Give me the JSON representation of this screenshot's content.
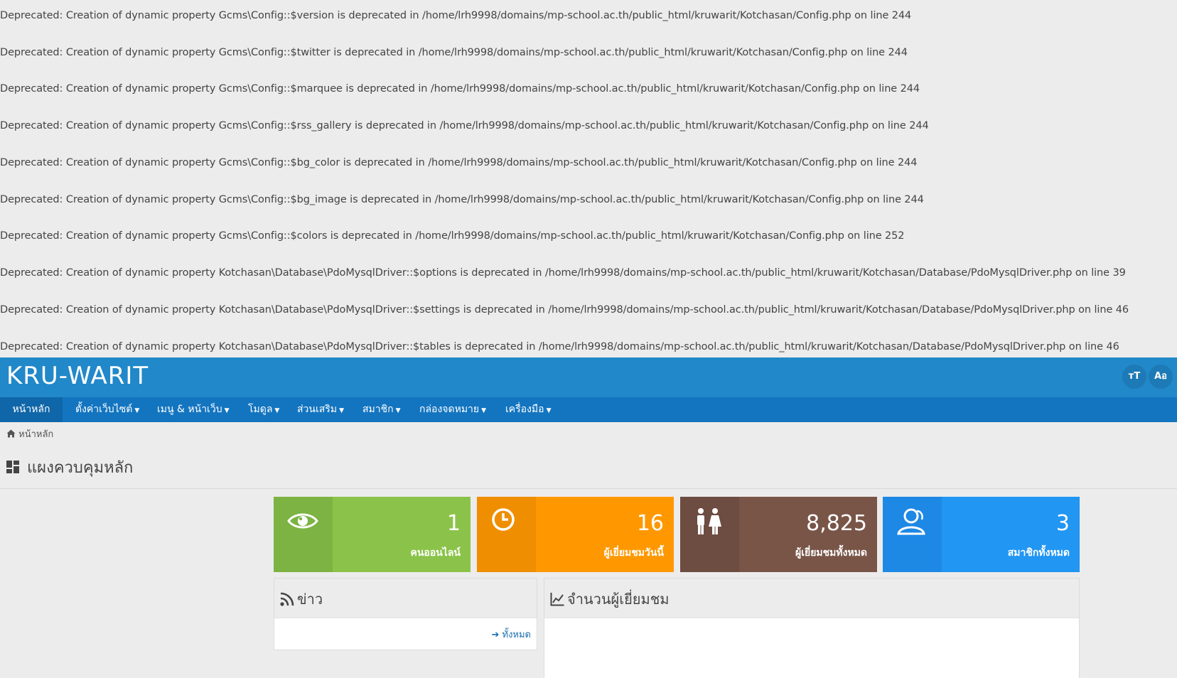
{
  "errors": [
    "Deprecated: Creation of dynamic property Gcms\\Config::$version is deprecated in /home/lrh9998/domains/mp-school.ac.th/public_html/kruwarit/Kotchasan/Config.php on line 244",
    "Deprecated: Creation of dynamic property Gcms\\Config::$twitter is deprecated in /home/lrh9998/domains/mp-school.ac.th/public_html/kruwarit/Kotchasan/Config.php on line 244",
    "Deprecated: Creation of dynamic property Gcms\\Config::$marquee is deprecated in /home/lrh9998/domains/mp-school.ac.th/public_html/kruwarit/Kotchasan/Config.php on line 244",
    "Deprecated: Creation of dynamic property Gcms\\Config::$rss_gallery is deprecated in /home/lrh9998/domains/mp-school.ac.th/public_html/kruwarit/Kotchasan/Config.php on line 244",
    "Deprecated: Creation of dynamic property Gcms\\Config::$bg_color is deprecated in /home/lrh9998/domains/mp-school.ac.th/public_html/kruwarit/Kotchasan/Config.php on line 244",
    "Deprecated: Creation of dynamic property Gcms\\Config::$bg_image is deprecated in /home/lrh9998/domains/mp-school.ac.th/public_html/kruwarit/Kotchasan/Config.php on line 244",
    "Deprecated: Creation of dynamic property Gcms\\Config::$colors is deprecated in /home/lrh9998/domains/mp-school.ac.th/public_html/kruwarit/Kotchasan/Config.php on line 252",
    "Deprecated: Creation of dynamic property Kotchasan\\Database\\PdoMysqlDriver::$options is deprecated in /home/lrh9998/domains/mp-school.ac.th/public_html/kruwarit/Kotchasan/Database/PdoMysqlDriver.php on line 39",
    "Deprecated: Creation of dynamic property Kotchasan\\Database\\PdoMysqlDriver::$settings is deprecated in /home/lrh9998/domains/mp-school.ac.th/public_html/kruwarit/Kotchasan/Database/PdoMysqlDriver.php on line 46",
    "Deprecated: Creation of dynamic property Kotchasan\\Database\\PdoMysqlDriver::$tables is deprecated in /home/lrh9998/domains/mp-school.ac.th/public_html/kruwarit/Kotchasan/Database/PdoMysqlDriver.php on line 46"
  ],
  "header": {
    "logo": "KRU-WARIT",
    "font_size_button": "тT",
    "language_button": "Aอ",
    "bg_color": "#2188c9"
  },
  "nav": {
    "items": [
      "หน้าหลัก",
      "ตั้งค่าเว็บไซต์",
      "เมนู & หน้าเว็บ",
      "โมดูล",
      "ส่วนเสริม",
      "สมาชิก",
      "กล่องจดหมาย",
      "เครื่องมือ"
    ],
    "bg_color": "#1375c0"
  },
  "breadcrumb": {
    "home_icon": "home-icon",
    "label": "หน้าหลัก"
  },
  "page": {
    "title": "แผงควบคุมหลัก",
    "title_icon": "dashboard-icon"
  },
  "cards": [
    {
      "value": "1",
      "label": "คนออนไลน์",
      "icon": "eye-icon",
      "color": "#8bc34a",
      "band_color": "#7cb342"
    },
    {
      "value": "16",
      "label": "ผู้เยี่ยมชมวันนี้",
      "icon": "clock-icon",
      "color": "#ff9800",
      "band_color": "#ef8e00"
    },
    {
      "value": "8,825",
      "label": "ผู้เยี่ยมชมทั้งหมด",
      "icon": "people-icon",
      "color": "#795548",
      "band_color": "#6d4c41"
    },
    {
      "value": "3",
      "label": "สมาชิกทั้งหมด",
      "icon": "users-icon",
      "color": "#2196f3",
      "band_color": "#1e88e5"
    }
  ],
  "news_panel": {
    "title": "ข่าว",
    "icon": "rss-icon",
    "more_label": "ทั้งหมด"
  },
  "visitors_panel": {
    "title": "จำนวนผู้เยี่ยมชม",
    "icon": "chart-line-icon"
  }
}
